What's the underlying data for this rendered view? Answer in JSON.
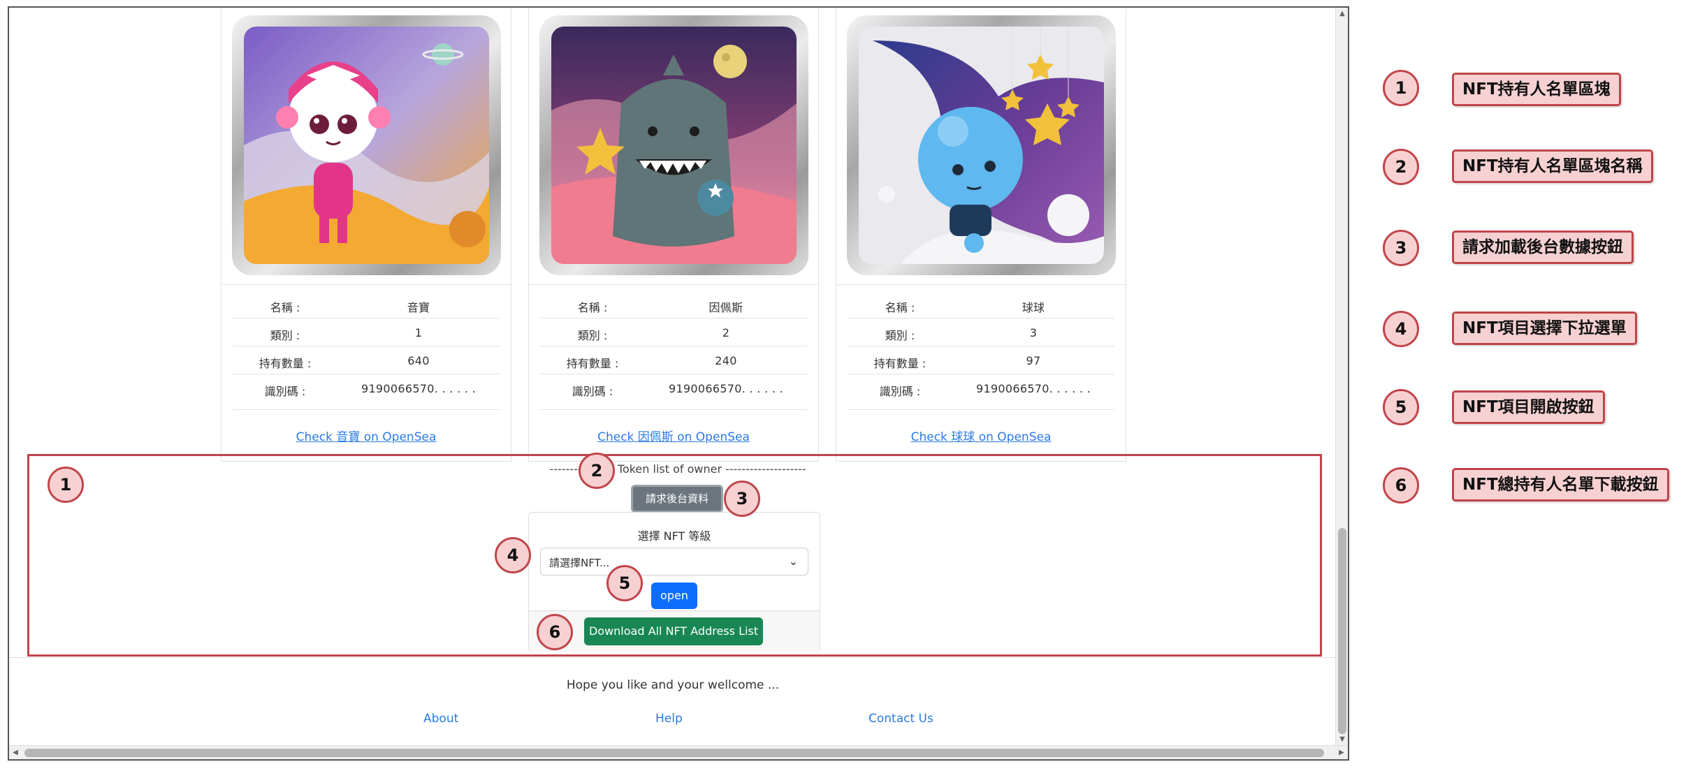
{
  "cards": [
    {
      "fields": [
        {
          "label": "名稱 :",
          "value": "音寶"
        },
        {
          "label": "類別 :",
          "value": "1"
        },
        {
          "label": "持有數量 :",
          "value": "640"
        },
        {
          "label": "識別碼 :",
          "value": "9190066570. . . . . ."
        }
      ],
      "link": "Check 音寶 on OpenSea"
    },
    {
      "fields": [
        {
          "label": "名稱 :",
          "value": "因佩斯"
        },
        {
          "label": "類別 :",
          "value": "2"
        },
        {
          "label": "持有數量 :",
          "value": "240"
        },
        {
          "label": "識別碼 :",
          "value": "9190066570. . . . . ."
        }
      ],
      "link": "Check 因佩斯 on OpenSea"
    },
    {
      "fields": [
        {
          "label": "名稱 :",
          "value": "球球"
        },
        {
          "label": "類別 :",
          "value": "3"
        },
        {
          "label": "持有數量 :",
          "value": "97"
        },
        {
          "label": "識別碼 :",
          "value": "9190066570. . . . . ."
        }
      ],
      "link": "Check 球球 on OpenSea"
    }
  ],
  "owner_section": {
    "title": "---------------- Token list of owner --------------------",
    "load_button": "請求後台資料",
    "select_label": "選擇 NFT 等級",
    "select_placeholder": "請選擇NFT...",
    "open_button": "open",
    "download_button": "Download All NFT Address List"
  },
  "footer": {
    "message": "Hope you like and your wellcome ...",
    "links": [
      "About",
      "Help",
      "Contact Us"
    ]
  },
  "annotations": {
    "markers": [
      "1",
      "2",
      "3",
      "4",
      "5",
      "6"
    ],
    "legend": [
      {
        "num": "1",
        "text": "NFT持有人名單區塊"
      },
      {
        "num": "2",
        "text": "NFT持有人名單區塊名稱"
      },
      {
        "num": "3",
        "text": "請求加載後台數據按鈕"
      },
      {
        "num": "4",
        "text": "NFT項目選擇下拉選單"
      },
      {
        "num": "5",
        "text": "NFT項目開啟按鈕"
      },
      {
        "num": "6",
        "text": "NFT總持有人名單下載按鈕"
      }
    ]
  },
  "colors": {
    "annotation_red": "#c0454a",
    "annotation_fill": "#f7d1d2",
    "link_blue": "#2a7ae2",
    "primary_button": "#0d6efd",
    "success_button": "#198754",
    "secondary_button": "#6c757d"
  }
}
